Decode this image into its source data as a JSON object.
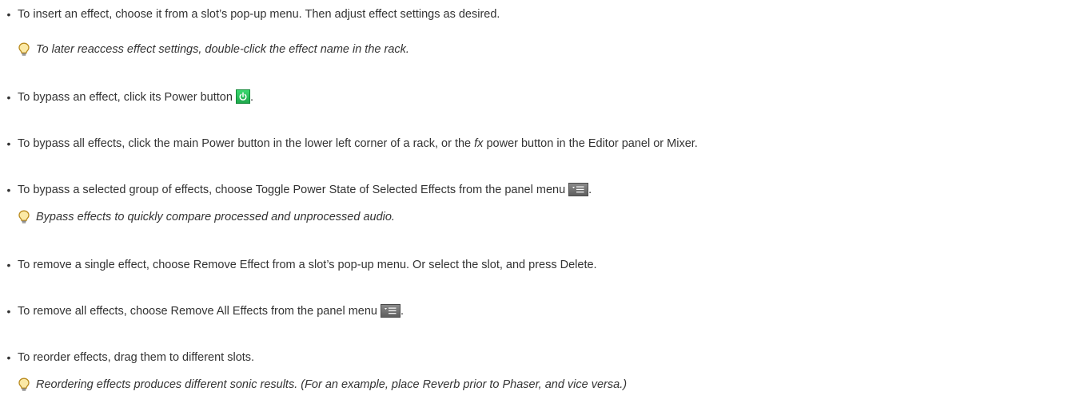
{
  "bullets": [
    {
      "text": "To insert an effect, choose it from a slot’s pop-up menu. Then adjust effect settings as desired."
    },
    {
      "text_before": "To bypass an effect, click its Power button",
      "text_after": "."
    },
    {
      "text_before": "To bypass all effects, click the main Power button in the lower left corner of a rack, or the ",
      "italic": "fx",
      "text_after": " power button in the Editor panel or Mixer."
    },
    {
      "text_before": "To bypass a selected group of effects, choose Toggle Power State of Selected Effects from the panel menu",
      "text_after": "."
    },
    {
      "text": "To remove a single effect, choose Remove Effect from a slot’s pop-up menu. Or select the slot, and press Delete."
    },
    {
      "text_before": "To remove all effects, choose Remove All Effects from the panel menu",
      "text_after": "."
    },
    {
      "text": "To reorder effects, drag them to different slots."
    }
  ],
  "tips": [
    "To later reaccess effect settings, double-click the effect name in the rack.",
    "Bypass effects to quickly compare processed and unprocessed audio.",
    "Reordering effects produces different sonic results. (For an example, place Reverb prior to Phaser, and vice versa.)"
  ],
  "icons": {
    "tip": "lightbulb-icon",
    "power": "power-icon",
    "panel_menu": "panel-menu-icon"
  },
  "colors": {
    "text": "#333333",
    "tip_bulb": "#c9a227",
    "power_green": "#2ecc5f",
    "menu_gray": "#6e6e6e"
  }
}
